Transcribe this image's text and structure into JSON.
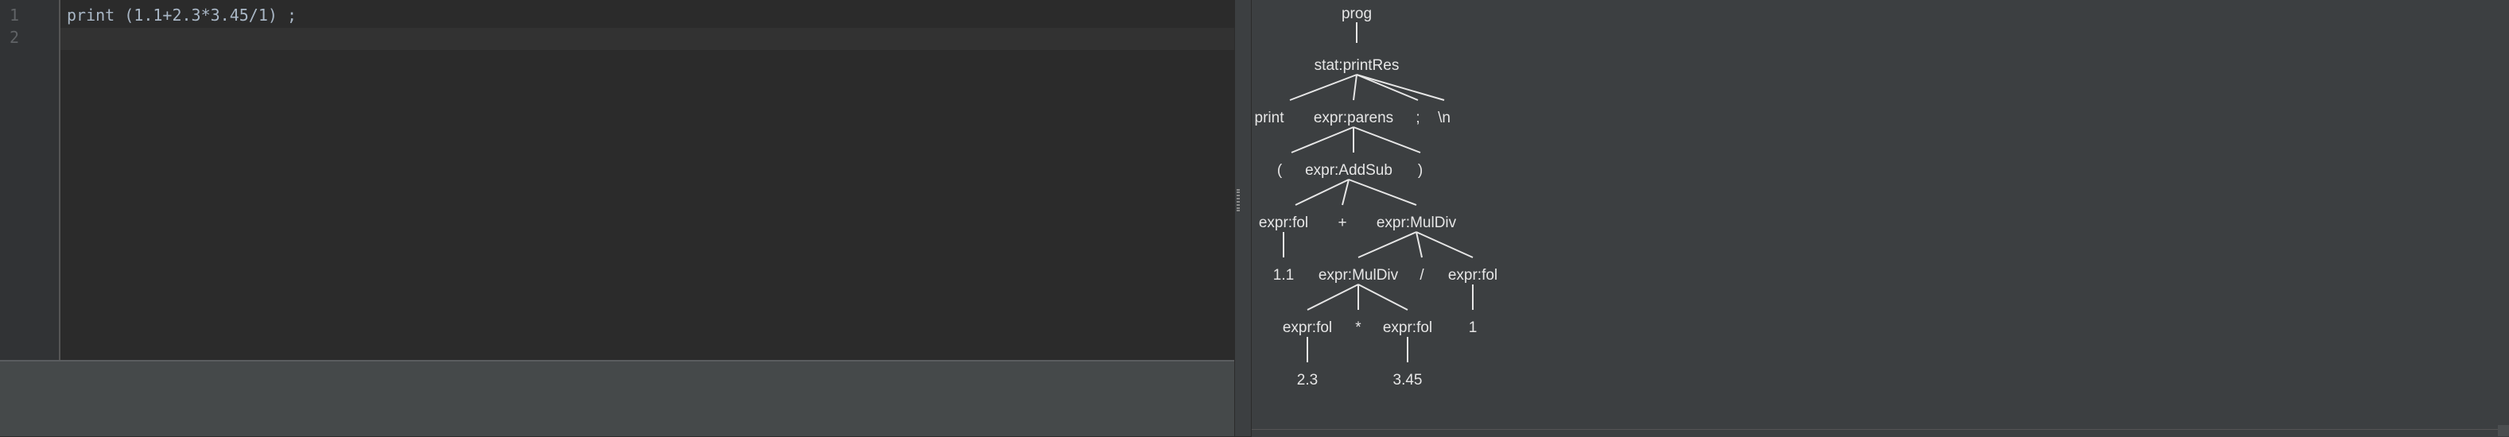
{
  "editor": {
    "line_numbers": [
      "1",
      "2"
    ],
    "lines": [
      "print (1.1+2.3*3.45/1) ;",
      ""
    ]
  },
  "parse_tree": {
    "node_labels": {
      "prog": "prog",
      "stat": "stat:printRes",
      "print": "print",
      "parens": "expr:parens",
      "semi": ";",
      "newline": "\\n",
      "lparen": "(",
      "addsub": "expr:AddSub",
      "rparen": ")",
      "fol11": "expr:fol",
      "plus": "+",
      "muldiv_outer": "expr:MulDiv",
      "v11": "1.1",
      "muldiv_inner": "expr:MulDiv",
      "slash": "/",
      "fol1": "expr:fol",
      "fol23": "expr:fol",
      "star": "*",
      "fol345": "expr:fol",
      "v1": "1",
      "v23": "2.3",
      "v345": "3.45"
    }
  }
}
